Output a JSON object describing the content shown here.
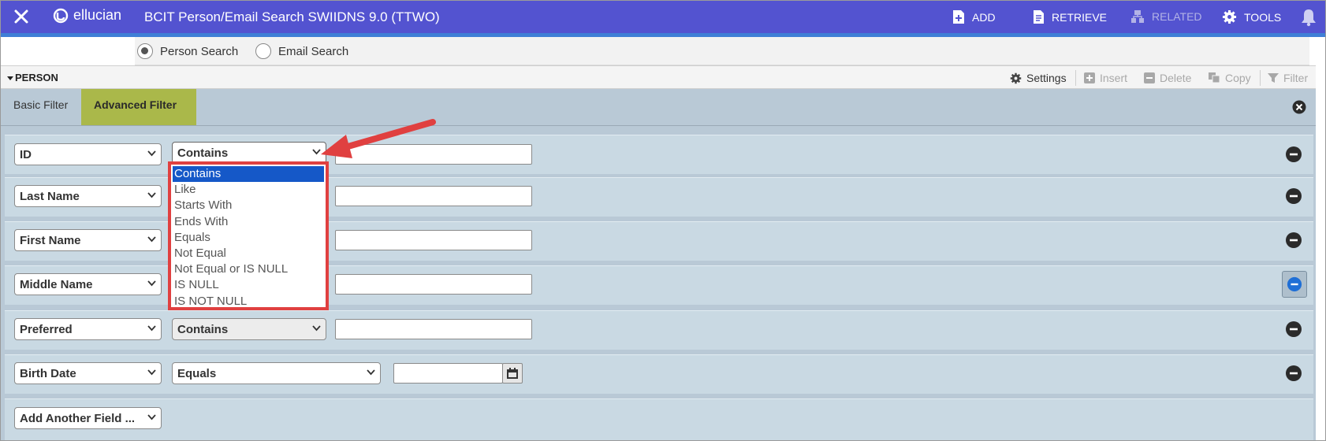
{
  "header": {
    "close_label": "close",
    "brand": "ellucian",
    "title": "BCIT Person/Email Search SWIIDNS 9.0 (TTWO)",
    "actions": [
      {
        "label": "ADD",
        "icon": "add-doc-icon",
        "enabled": true
      },
      {
        "label": "RETRIEVE",
        "icon": "retrieve-doc-icon",
        "enabled": true
      },
      {
        "label": "RELATED",
        "icon": "related-icon",
        "enabled": false
      },
      {
        "label": "TOOLS",
        "icon": "gear-icon",
        "enabled": true
      }
    ],
    "colors": {
      "bar": "#5353d0",
      "accent": "#3f7fd6"
    }
  },
  "search_type": {
    "options": [
      "Person Search",
      "Email Search"
    ],
    "selected": "Person Search"
  },
  "section": {
    "title": "PERSON",
    "tools": {
      "settings": "Settings",
      "insert": "Insert",
      "delete": "Delete",
      "copy": "Copy",
      "filter": "Filter"
    }
  },
  "filter": {
    "tabs": [
      "Basic Filter",
      "Advanced Filter"
    ],
    "active_tab": "Advanced Filter",
    "rows": [
      {
        "field": "ID",
        "operator": "Contains",
        "value": ""
      },
      {
        "field": "Last Name",
        "operator": "",
        "value": ""
      },
      {
        "field": "First Name",
        "operator": "",
        "value": ""
      },
      {
        "field": "Middle Name",
        "operator": "",
        "value": ""
      },
      {
        "field": "Preferred",
        "operator": "Contains",
        "value": ""
      },
      {
        "field": "Birth Date",
        "operator": "Equals",
        "value": ""
      }
    ],
    "add_field": "Add Another Field ..."
  },
  "operator_dropdown": {
    "options": [
      "Contains",
      "Like",
      "Starts With",
      "Ends With",
      "Equals",
      "Not Equal",
      "Not Equal or IS NULL",
      "IS NULL",
      "IS NOT NULL"
    ],
    "highlighted": "Contains",
    "callout_color": "#e04040"
  }
}
